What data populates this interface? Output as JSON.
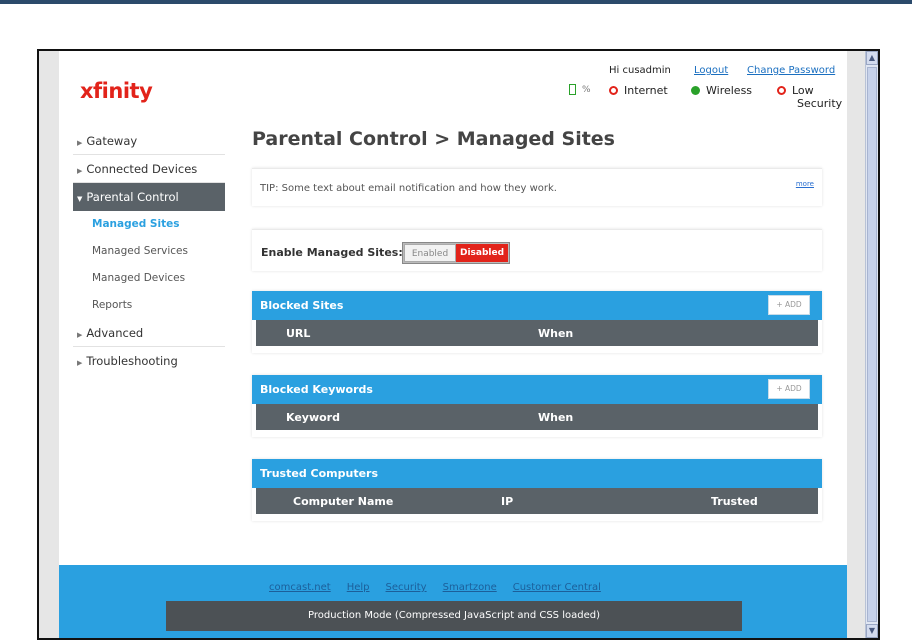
{
  "header": {
    "logo": "xfinity",
    "greeting": "Hi cusadmin",
    "logout": "Logout",
    "change_password": "Change Password",
    "battery_pct": "%",
    "internet": "Internet",
    "wireless": "Wireless",
    "security_level": "Low",
    "security_label": "Security"
  },
  "nav": {
    "gateway": "Gateway",
    "connected_devices": "Connected Devices",
    "parental_control": "Parental Control",
    "managed_sites": "Managed Sites",
    "managed_services": "Managed Services",
    "managed_devices": "Managed Devices",
    "reports": "Reports",
    "advanced": "Advanced",
    "troubleshooting": "Troubleshooting"
  },
  "main": {
    "title": "Parental Control > Managed Sites",
    "tip": "TIP: Some text about email notification and how they work.",
    "more": "more",
    "enable_label": "Enable Managed Sites:",
    "toggle_enabled": "Enabled",
    "toggle_disabled": "Disabled",
    "blocked_sites": {
      "title": "Blocked Sites",
      "add": "+ ADD",
      "columns": [
        "URL",
        "When"
      ]
    },
    "blocked_keywords": {
      "title": "Blocked Keywords",
      "add": "+ ADD",
      "columns": [
        "Keyword",
        "When"
      ]
    },
    "trusted_computers": {
      "title": "Trusted Computers",
      "columns": [
        "Computer Name",
        "IP",
        "Trusted"
      ]
    }
  },
  "footer": {
    "links": [
      "comcast.net",
      "Help",
      "Security",
      "Smartzone",
      "Customer Central"
    ],
    "production_mode": "Production Mode (Compressed JavaScript and CSS loaded)"
  },
  "colors": {
    "accent_blue": "#2aa0e0",
    "brand_red": "#e2231a",
    "nav_active": "#5a6268",
    "ok_green": "#2aa12a"
  }
}
